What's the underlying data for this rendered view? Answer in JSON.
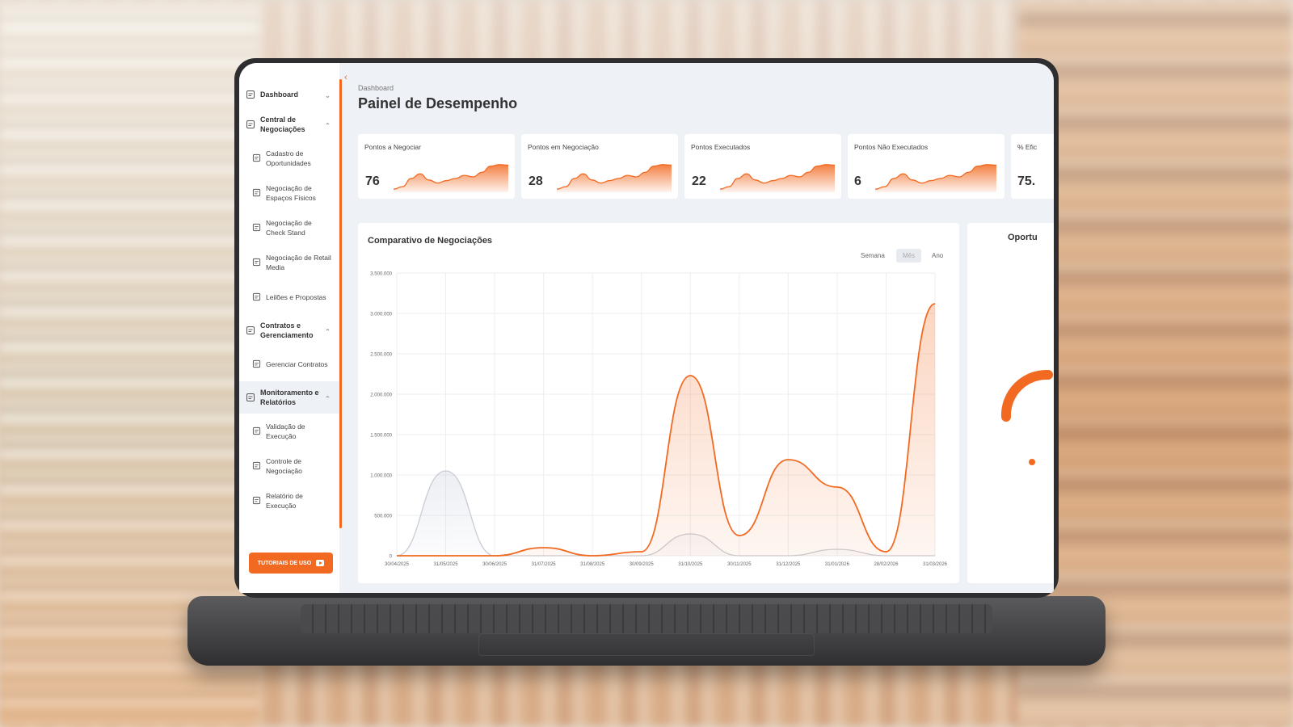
{
  "sidebar": {
    "groups": [
      {
        "label": "Dashboard",
        "icon": "grid-icon",
        "chevron": "down"
      },
      {
        "label": "Central de Negociações",
        "icon": "handshake-icon",
        "chevron": "up",
        "items": [
          {
            "label": "Cadastro de Oportunidades",
            "icon": "plus-circle-icon"
          },
          {
            "label": "Negociação de Espaços Físicos",
            "icon": "shelf-icon"
          },
          {
            "label": "Negociação de Check Stand",
            "icon": "checkout-icon"
          },
          {
            "label": "Negociação de Retail Media",
            "icon": "monitor-icon"
          },
          {
            "label": "Leilões e Propostas",
            "icon": "gavel-icon"
          }
        ]
      },
      {
        "label": "Contratos e Gerenciamento",
        "icon": "contract-icon",
        "chevron": "up",
        "items": [
          {
            "label": "Gerenciar Contratos",
            "icon": "document-gear-icon"
          }
        ]
      },
      {
        "label": "Monitoramento e Relatórios",
        "icon": "report-icon",
        "chevron": "up",
        "active": true,
        "items": [
          {
            "label": "Validação de Execução",
            "icon": "check-document-icon"
          },
          {
            "label": "Controle de Negociação",
            "icon": "control-icon"
          },
          {
            "label": "Relatório de Execução",
            "icon": "report-doc-icon"
          }
        ]
      }
    ],
    "tutorial_button": "TUTORIAIS DE USO"
  },
  "header": {
    "breadcrumb": "Dashboard",
    "title": "Painel de Desempenho"
  },
  "kpis": [
    {
      "label": "Pontos a Negociar",
      "value": "76"
    },
    {
      "label": "Pontos em Negociação",
      "value": "28"
    },
    {
      "label": "Pontos Executados",
      "value": "22"
    },
    {
      "label": "Pontos Não Executados",
      "value": "6"
    },
    {
      "label": "% Efic",
      "value": "75."
    }
  ],
  "chart": {
    "title": "Comparativo de Negociações",
    "periods": [
      "Semana",
      "Mês",
      "Ano"
    ],
    "active_period": "Mês"
  },
  "side_card": {
    "title": "Oportu"
  },
  "colors": {
    "accent": "#f26a21",
    "secondary_series": "#c8ccd4"
  },
  "chart_data": {
    "type": "area",
    "title": "Comparativo de Negociações",
    "x": [
      "30/04/2025",
      "31/05/2025",
      "30/06/2025",
      "31/07/2025",
      "31/08/2025",
      "30/09/2025",
      "31/10/2025",
      "30/11/2025",
      "31/12/2025",
      "31/01/2026",
      "28/02/2026",
      "31/03/2026"
    ],
    "ylim": [
      0,
      3500000
    ],
    "yticks": [
      0,
      500000,
      1000000,
      1500000,
      2000000,
      2500000,
      3000000,
      3500000
    ],
    "ytick_labels": [
      "0",
      "500.000",
      "1.000.000",
      "1.500.000",
      "2.000.000",
      "2.500.000",
      "3.000.000",
      "3.500.000"
    ],
    "grid": true,
    "series": [
      {
        "color": "#c8ccd4",
        "values": [
          0,
          1050000,
          0,
          0,
          0,
          0,
          270000,
          0,
          0,
          80000,
          0,
          0
        ]
      },
      {
        "color": "#f26a21",
        "values": [
          0,
          0,
          0,
          100000,
          0,
          50000,
          2230000,
          250000,
          1190000,
          850000,
          50000,
          3120000
        ]
      }
    ]
  }
}
